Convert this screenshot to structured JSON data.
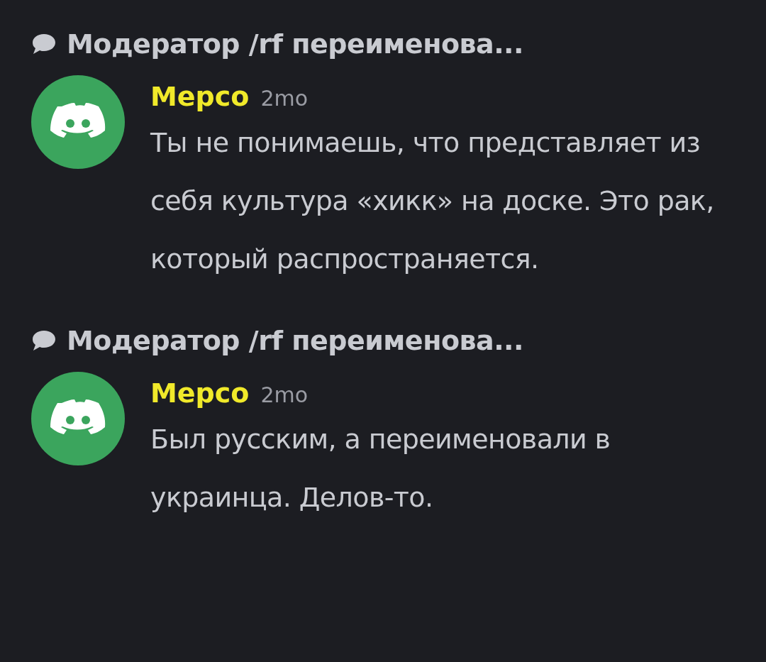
{
  "threads": [
    {
      "title": "Модератор /rf переименова...",
      "message": {
        "author": "Мерсо",
        "time": "2mo",
        "text": "Ты не понимаешь, что представляет из себя культура «хикк» на доске. Это рак, который распространяется."
      }
    },
    {
      "title": "Модератор /rf переименова...",
      "message": {
        "author": "Мерсо",
        "time": "2mo",
        "text": "Был русским, а переименовали в украинца. Делов-то."
      }
    }
  ]
}
